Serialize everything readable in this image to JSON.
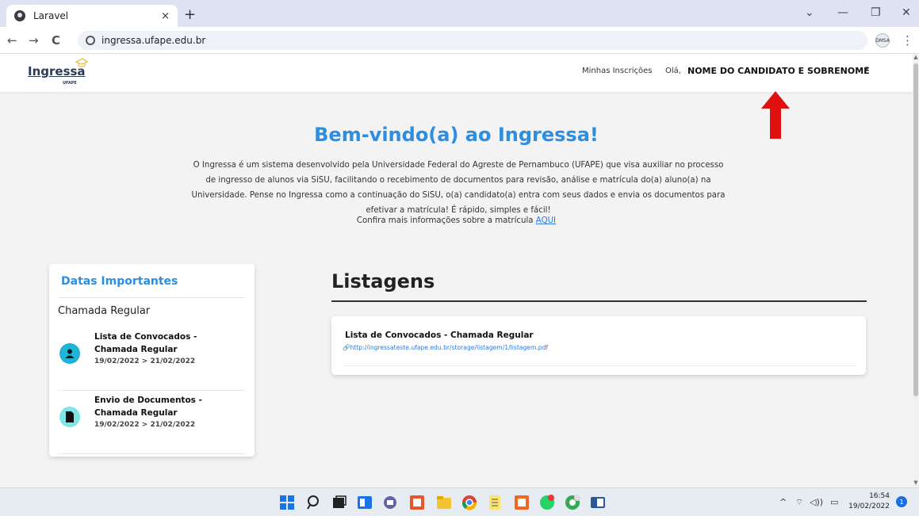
{
  "browser": {
    "tab_title": "Laravel",
    "tab_close": "×",
    "new_tab": "+",
    "url": "ingressa.ufape.edu.br",
    "back": "←",
    "forward": "→",
    "reload": "C",
    "menu": "⋮",
    "profile_label": "DMSA",
    "minimize": "—",
    "restore": "❐",
    "close": "✕",
    "chevron": "⌄"
  },
  "site": {
    "logo_word": "Ingressa",
    "logo_sub": "UFAPE",
    "nav_inscricoes": "Minhas Inscrições",
    "greeting": "Olá,",
    "user_name": "NOME DO CANDIDATO E SOBRENOME",
    "caret": "▾"
  },
  "welcome": {
    "title": "Bem-vindo(a) ao Ingressa!",
    "line1": "O Ingressa é um sistema desenvolvido pela Universidade Federal do Agreste de Pernambuco (UFAPE) que visa auxiliar no processo",
    "line2": "de ingresso de alunos via SiSU, facilitando o recebimento de documentos para revisão, análise e matrícula do(a) aluno(a) na",
    "line3": "Universidade. Pense no Ingressa como a continuação do SiSU, o(a) candidato(a) entra com seus dados e envia os documentos para",
    "line4": "efetivar a matrícula! É rápido, simples e fácil!",
    "more_text": "Confira mais informações sobre a matrícula ",
    "more_link": "AQUI"
  },
  "dates": {
    "title": "Datas Importantes",
    "section": "Chamada Regular",
    "items": [
      {
        "line1": "Lista de Convocados -",
        "line2": "Chamada Regular",
        "range": "19/02/2022 > 21/02/2022",
        "icon": "user-icon",
        "color": "#1fb3d6"
      },
      {
        "line1": "Envio de Documentos -",
        "line2": "Chamada Regular",
        "range": "19/02/2022 > 21/02/2022",
        "icon": "document-icon",
        "color": "#7ee6e6"
      }
    ]
  },
  "listagens": {
    "title": "Listagens",
    "item_title": "Lista de Convocados - Chamada Regular",
    "item_link": "http://ingressateste.ufape.edu.br/storage/listagem/1/listagem.pdf"
  },
  "taskbar": {
    "time": "16:54",
    "date": "19/02/2022",
    "notifications": "1",
    "tray_up": "^",
    "tray_wifi": "⌔",
    "tray_volume": "◁))",
    "tray_battery": "▭"
  },
  "colors": {
    "accent": "#2c8ee0",
    "arrow": "#e01010"
  }
}
